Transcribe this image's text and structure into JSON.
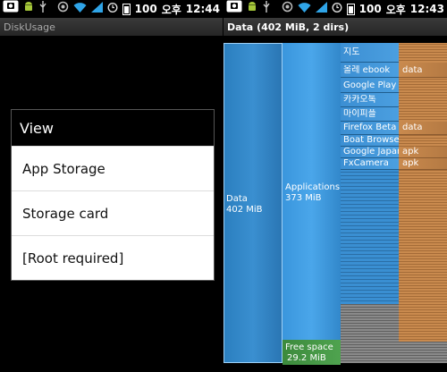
{
  "left_screen": {
    "status": {
      "battery": "100",
      "carrier": "오후",
      "time": "12:44"
    },
    "app_title": "DiskUsage",
    "dialog": {
      "title": "View",
      "items": [
        "App Storage",
        "Storage card",
        "[Root required]"
      ]
    }
  },
  "right_screen": {
    "status": {
      "battery": "100",
      "carrier": "오후",
      "time": "12:43"
    },
    "title": "Data (402 MiB, 2 dirs)",
    "blocks": {
      "data": {
        "name": "Data",
        "size": "402 MiB"
      },
      "applications": {
        "name": "Applications",
        "size": "373 MiB"
      },
      "free": {
        "name": "Free space",
        "size": "29.2 MiB"
      }
    },
    "apps": [
      {
        "name": "지도",
        "sub": ""
      },
      {
        "name": "올레 ebook",
        "sub": "data"
      },
      {
        "name": "Google Play 북",
        "sub": ""
      },
      {
        "name": "카카오톡",
        "sub": ""
      },
      {
        "name": "마이피플",
        "sub": ""
      },
      {
        "name": "Firefox Beta",
        "sub": "data"
      },
      {
        "name": "Boat Browser",
        "sub": ""
      },
      {
        "name": "Google Japan",
        "sub": "apk"
      },
      {
        "name": "FxCamera",
        "sub": "apk"
      }
    ]
  },
  "colors": {
    "treemap_blue": "#3a8fd0",
    "treemap_orange": "#c98a4e",
    "free_green": "#3c8a3c",
    "dialog_bg": "#ffffff"
  },
  "icons": [
    "screenshot-icon",
    "android-icon",
    "usb-icon",
    "sync-icon",
    "wifi-icon",
    "signal-icon",
    "alarm-icon",
    "battery-icon"
  ]
}
